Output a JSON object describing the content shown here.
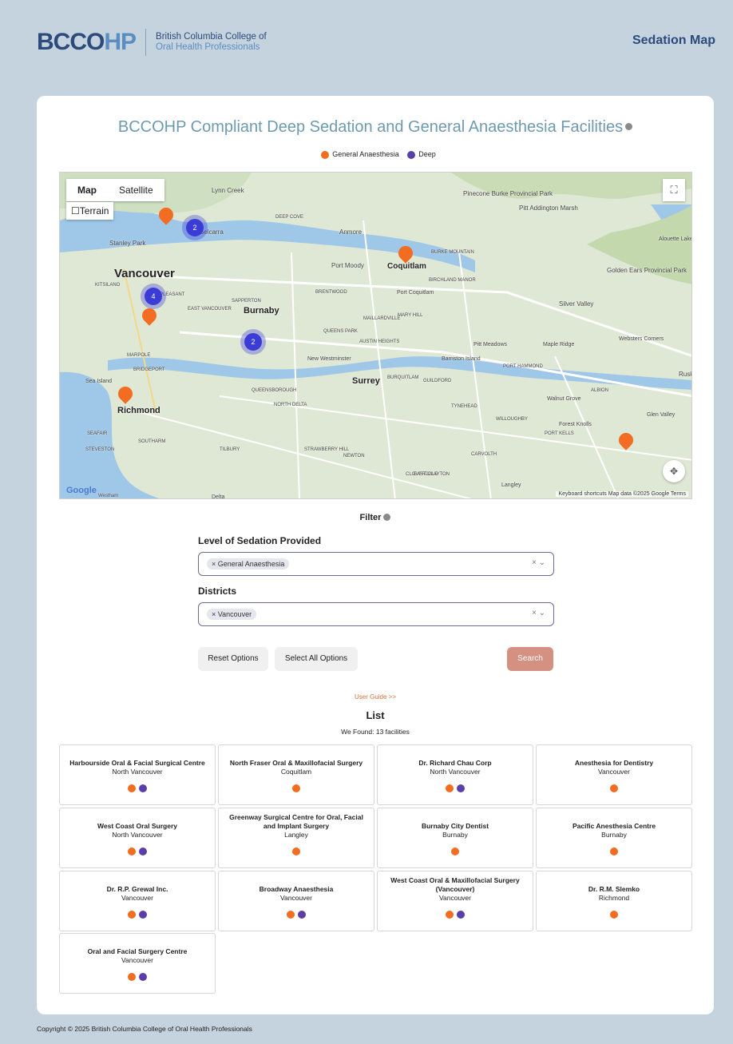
{
  "header": {
    "logo_main_a": "BCCO",
    "logo_main_b": "HP",
    "logo_sub_line1": "British Columbia College of",
    "logo_sub_line2": "Oral Health Professionals",
    "site_title": "Sedation Map"
  },
  "page": {
    "title": "BCCOHP Compliant Deep Sedation and General Anaesthesia Facilities"
  },
  "legend": {
    "items": [
      {
        "label": "General Anaesthesia",
        "color": "#f26d21"
      },
      {
        "label": "Deep",
        "color": "#5b3fa8"
      }
    ]
  },
  "map": {
    "type_options": [
      "Map",
      "Satellite"
    ],
    "selected_type": "Map",
    "terrain_label": "Terrain",
    "footer": "Keyboard shortcuts   Map data ©2025 Google   Terms",
    "google_logo": "Google",
    "places": [
      "Lynn Creek",
      "Vancouver",
      "Stanley Park",
      "KITSILANO",
      "Burnaby",
      "Port Moody",
      "Coquitlam",
      "Port Coquitlam",
      "Pinecone Burke Provincial Park",
      "Pitt Addington Marsh",
      "Golden Ears Provincial Park",
      "Silver Valley",
      "Pitt Meadows",
      "Maple Ridge",
      "Websters Corners",
      "Barnston Island",
      "Surrey",
      "New Westminster",
      "Richmond",
      "Sea Island",
      "Walnut Grove",
      "Glen Valley",
      "Forest Knolls",
      "Langley",
      "Delta",
      "Westham",
      "STEVESTON",
      "SEAFAIR",
      "SOUTHARM",
      "TILBURY",
      "MARPOLE",
      "BRIDGEPORT",
      "QUEENSBOROUGH",
      "NORTH DELTA",
      "STRAWBERRY HILL",
      "NEWTON",
      "CLOVERDALE",
      "EAST CLAYTON",
      "CARVOLTH",
      "WILLOUGHBY",
      "PORT KELLS",
      "TYNEHEAD",
      "GUILDFORD",
      "BURQUITLAM",
      "BRENTWOOD",
      "SAPPERTON",
      "QUEENS PARK",
      "AUSTIN HEIGHTS",
      "MAILLARDVILLE",
      "MARY HILL",
      "BIRCHLAND MANOR",
      "BURKE MOUNTAIN",
      "Belcarra",
      "Anmore",
      "DEEP COVE",
      "PLEASANT",
      "EAST VANCOUVER",
      "PORT HAMMOND",
      "ALBION",
      "Rusk",
      "Alouette Lake"
    ],
    "clusters": [
      {
        "count": "2"
      },
      {
        "count": "4"
      },
      {
        "count": "2"
      }
    ]
  },
  "filter": {
    "heading": "Filter",
    "sedation_label": "Level of Sedation Provided",
    "sedation_value": "General Anaesthesia",
    "districts_label": "Districts",
    "districts_value": "Vancouver",
    "clear_glyph": "×  ⌄",
    "reset_label": "Reset Options",
    "select_all_label": "Select All Options",
    "search_label": "Search"
  },
  "list": {
    "guide": "User Guide >>",
    "heading": "List",
    "found": "We Found: 13 facilities",
    "facilities": [
      {
        "name": "Harbourside Oral & Facial Surgical Centre",
        "city": "North Vancouver",
        "ga": true,
        "deep": true
      },
      {
        "name": "North Fraser Oral & Maxillofacial Surgery",
        "city": "Coquitlam",
        "ga": true,
        "deep": false
      },
      {
        "name": "Dr. Richard Chau Corp",
        "city": "North Vancouver",
        "ga": true,
        "deep": true
      },
      {
        "name": "Anesthesia for Dentistry",
        "city": "Vancouver",
        "ga": true,
        "deep": false
      },
      {
        "name": "West Coast Oral Surgery",
        "city": "North Vancouver",
        "ga": true,
        "deep": true
      },
      {
        "name": "Greenway Surgical Centre for Oral, Facial and Implant Surgery",
        "city": "Langley",
        "ga": true,
        "deep": false
      },
      {
        "name": "Burnaby City Dentist",
        "city": "Burnaby",
        "ga": true,
        "deep": false
      },
      {
        "name": "Pacific Anesthesia Centre",
        "city": "Burnaby",
        "ga": true,
        "deep": false
      },
      {
        "name": "Dr. R.P. Grewal Inc.",
        "city": "Vancouver",
        "ga": true,
        "deep": true
      },
      {
        "name": "Broadway Anaesthesia",
        "city": "Vancouver",
        "ga": true,
        "deep": true
      },
      {
        "name": "West Coast Oral & Maxillofacial Surgery (Vancouver)",
        "city": "Vancouver",
        "ga": true,
        "deep": true
      },
      {
        "name": "Dr. R.M. Slemko",
        "city": "Richmond",
        "ga": true,
        "deep": false
      },
      {
        "name": "Oral and Facial Surgery Centre",
        "city": "Vancouver",
        "ga": true,
        "deep": true
      }
    ]
  },
  "footer": {
    "copyright": "Copyright © 2025  British Columbia College of Oral Health Professionals"
  },
  "colors": {
    "ga": "#f26d21",
    "deep": "#5b3fa8",
    "search_button": "#d49080",
    "background": "#c5d3df"
  }
}
